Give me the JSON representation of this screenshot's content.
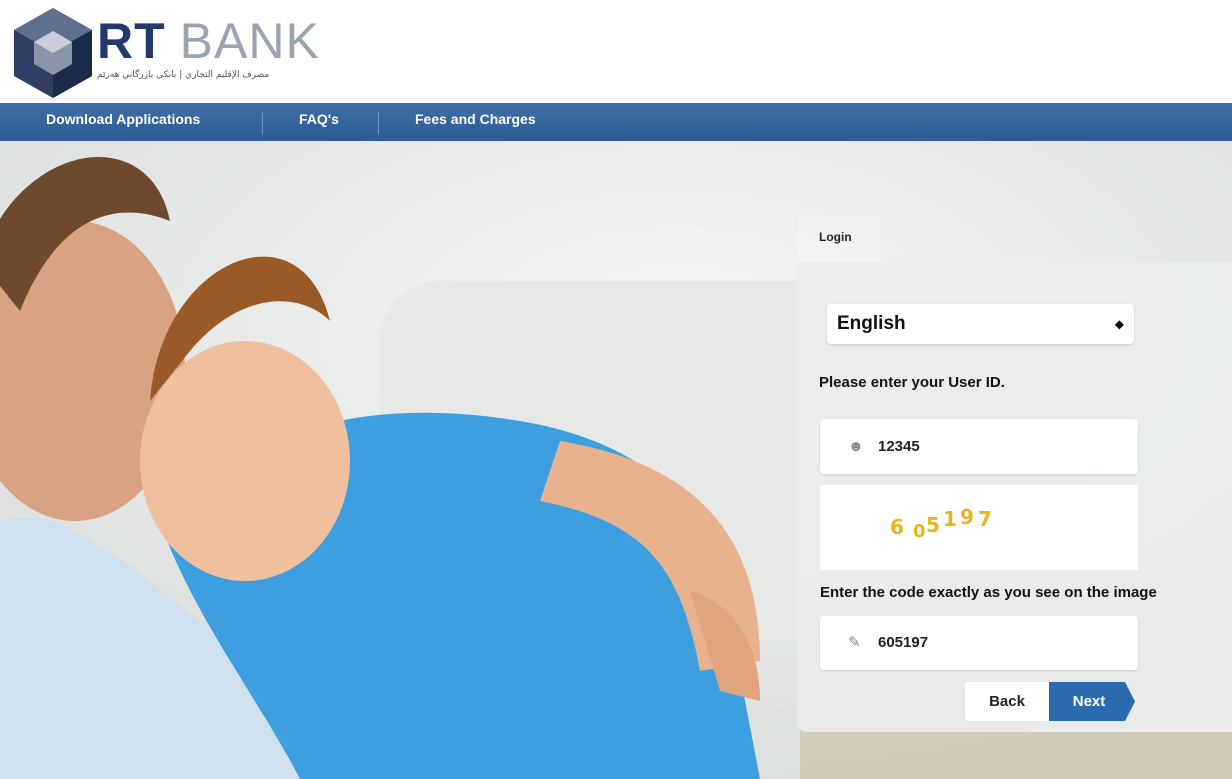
{
  "brand": {
    "name_rt": "RT",
    "name_bank": "BANK",
    "tagline": "مصرف الإقليم التجاري | بانكي بازرگاني هەرێم",
    "primary_color": "#2b5b92",
    "logo_icon": "cube-logo-icon"
  },
  "nav": {
    "items": [
      {
        "label": "Download Applications"
      },
      {
        "label": "FAQ's"
      },
      {
        "label": "Fees and Charges"
      }
    ]
  },
  "login": {
    "tab_label": "Login",
    "language": {
      "selected": "English"
    },
    "user_prompt": "Please enter your User ID.",
    "user_id": {
      "value": "12345",
      "icon": "user-icon"
    },
    "captcha": {
      "digits": [
        "6",
        "0",
        "5",
        "1",
        "9",
        "7"
      ],
      "color": "#e8b51a"
    },
    "code_prompt": "Enter the code exactly as you see on the image",
    "code_input": {
      "value": "605197",
      "icon": "edit-icon"
    },
    "back_label": "Back",
    "next_label": "Next"
  }
}
